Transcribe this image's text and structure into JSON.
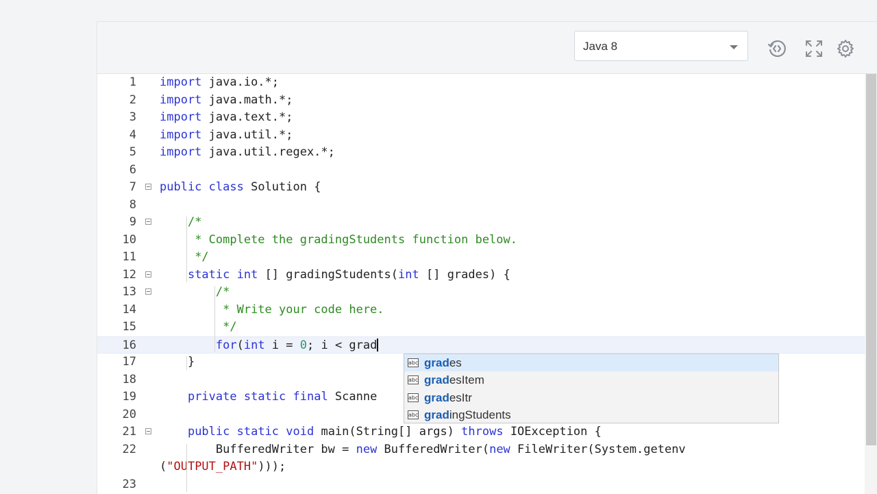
{
  "toolbar": {
    "language": "Java 8",
    "icons": [
      "history-icon",
      "fullscreen-icon",
      "gear-icon"
    ]
  },
  "editor": {
    "lines": [
      {
        "n": "1",
        "tokens": [
          [
            "kw",
            "import"
          ],
          [
            "",
            "java.io.*;"
          ]
        ]
      },
      {
        "n": "2",
        "tokens": [
          [
            "kw",
            "import"
          ],
          [
            "",
            "java.math.*;"
          ]
        ]
      },
      {
        "n": "3",
        "tokens": [
          [
            "kw",
            "import"
          ],
          [
            "",
            "java.text.*;"
          ]
        ]
      },
      {
        "n": "4",
        "tokens": [
          [
            "kw",
            "import"
          ],
          [
            "",
            "java.util.*;"
          ]
        ]
      },
      {
        "n": "5",
        "tokens": [
          [
            "kw",
            "import"
          ],
          [
            "",
            "java.util.regex.*;"
          ]
        ]
      },
      {
        "n": "6",
        "tokens": []
      },
      {
        "n": "7",
        "fold": true,
        "tokens": [
          [
            "kw",
            "public"
          ],
          [
            "kw",
            "class"
          ],
          [
            "",
            "Solution {"
          ]
        ]
      },
      {
        "n": "8",
        "tokens": []
      },
      {
        "n": "9",
        "fold": true,
        "indent": 4,
        "tokens": [
          [
            "cm",
            "/*"
          ]
        ]
      },
      {
        "n": "10",
        "indent": 4,
        "tokens": [
          [
            "cm",
            " * Complete the gradingStudents function below."
          ]
        ]
      },
      {
        "n": "11",
        "indent": 4,
        "tokens": [
          [
            "cm",
            " */"
          ]
        ]
      },
      {
        "n": "12",
        "fold": true,
        "indent": 4,
        "tokens": [
          [
            "kw",
            "static"
          ],
          [
            "kw",
            "int"
          ],
          [
            "",
            "[] gradingStudents("
          ],
          [
            "kw",
            "int"
          ],
          [
            "",
            "[] grades) {"
          ]
        ]
      },
      {
        "n": "13",
        "fold": true,
        "indent": 8,
        "tokens": [
          [
            "cm",
            "/*"
          ]
        ]
      },
      {
        "n": "14",
        "indent": 8,
        "tokens": [
          [
            "cm",
            " * Write your code here."
          ]
        ]
      },
      {
        "n": "15",
        "indent": 8,
        "tokens": [
          [
            "cm",
            " */"
          ]
        ]
      },
      {
        "n": "16",
        "indent": 8,
        "active": true,
        "tokens": [
          [
            "kw",
            "for"
          ],
          [
            "",
            "("
          ],
          [
            "kw",
            "int"
          ],
          [
            "",
            "i = "
          ],
          [
            "num",
            "0"
          ],
          [
            "",
            "; i < grad"
          ]
        ]
      },
      {
        "n": "17",
        "indent": 4,
        "tokens": [
          [
            "",
            "}"
          ]
        ]
      },
      {
        "n": "18",
        "tokens": []
      },
      {
        "n": "19",
        "indent": 4,
        "tokens": [
          [
            "kw",
            "private"
          ],
          [
            "kw",
            "static"
          ],
          [
            "kw",
            "final"
          ],
          [
            "",
            "Scanne"
          ]
        ]
      },
      {
        "n": "20",
        "tokens": []
      },
      {
        "n": "21",
        "fold": true,
        "indent": 4,
        "tokens": [
          [
            "kw",
            "public"
          ],
          [
            "kw",
            "static"
          ],
          [
            "kw",
            "void"
          ],
          [
            "",
            "main(String[] args) "
          ],
          [
            "kw",
            "throws"
          ],
          [
            "",
            "IOException {"
          ]
        ]
      },
      {
        "n": "22",
        "indent": 8,
        "tokens": [
          [
            "",
            "BufferedWriter bw = "
          ],
          [
            "kw",
            "new"
          ],
          [
            "",
            "BufferedWriter("
          ],
          [
            "kw",
            "new"
          ],
          [
            "",
            "FileWriter(System.getenv"
          ]
        ]
      },
      {
        "n": "",
        "indent": 0,
        "tokens": [
          [
            "",
            "("
          ],
          [
            "str",
            "\"OUTPUT_PATH\""
          ],
          [
            "",
            ")));"
          ]
        ]
      },
      {
        "n": "23",
        "tokens": []
      }
    ]
  },
  "suggestions": {
    "icon_label": "abc",
    "query": "grad",
    "items": [
      {
        "match": "grad",
        "rest": "es",
        "selected": true
      },
      {
        "match": "grad",
        "rest": "esItem"
      },
      {
        "match": "grad",
        "rest": "esItr"
      },
      {
        "match": "grad",
        "rest": "ingStudents"
      }
    ]
  }
}
